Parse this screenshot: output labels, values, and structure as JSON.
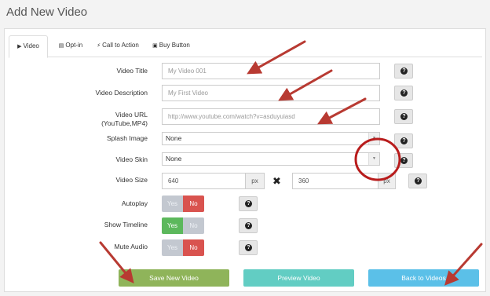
{
  "page": {
    "title": "Add New Video"
  },
  "tabs": [
    {
      "label": "Video",
      "icon": "play-circle-icon",
      "glyph": "▶",
      "active": true
    },
    {
      "label": "Opt-in",
      "icon": "list-icon",
      "glyph": "▤",
      "active": false
    },
    {
      "label": "Call to Action",
      "icon": "bolt-icon",
      "glyph": "⚡",
      "active": false
    },
    {
      "label": "Buy Button",
      "icon": "money-icon",
      "glyph": "▣",
      "active": false
    }
  ],
  "form": {
    "video_title": {
      "label": "Video Title",
      "placeholder": "My Video 001"
    },
    "video_description": {
      "label": "Video Description",
      "placeholder": "My First Video"
    },
    "video_url": {
      "label_line1": "Video URL",
      "label_line2": "(YouTube,MP4)",
      "value": "http://www.youtube.com/watch?v=asduyuiasd"
    },
    "splash_image": {
      "label": "Splash Image",
      "value": "None"
    },
    "video_skin": {
      "label": "Video Skin",
      "value": "None"
    },
    "video_size": {
      "label": "Video Size",
      "width": "640",
      "height": "360",
      "unit": "px",
      "separator": "✖"
    },
    "autoplay": {
      "label": "Autoplay",
      "yes": "Yes",
      "no": "No",
      "selected": "No"
    },
    "show_timeline": {
      "label": "Show Timeline",
      "yes": "Yes",
      "no": "No",
      "selected": "Yes"
    },
    "mute_audio": {
      "label": "Mute Audio",
      "yes": "Yes",
      "no": "No",
      "selected": "No"
    },
    "help_glyph": "?"
  },
  "buttons": {
    "save": {
      "label": "Save New Video",
      "color": "#8fb45a"
    },
    "preview": {
      "label": "Preview Video",
      "color": "#62cdc3"
    },
    "back": {
      "label": "Back to Videos",
      "color": "#5bc0e8"
    }
  },
  "annotations": {
    "arrow_color": "#b83a32",
    "circle_color": "#b81c1c"
  }
}
